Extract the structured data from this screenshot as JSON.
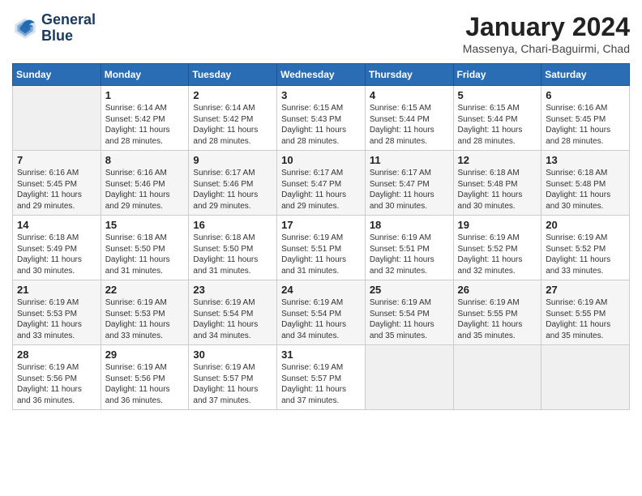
{
  "logo": {
    "line1": "General",
    "line2": "Blue"
  },
  "title": "January 2024",
  "subtitle": "Massenya, Chari-Baguirmi, Chad",
  "days_of_week": [
    "Sunday",
    "Monday",
    "Tuesday",
    "Wednesday",
    "Thursday",
    "Friday",
    "Saturday"
  ],
  "weeks": [
    [
      {
        "day": "",
        "info": ""
      },
      {
        "day": "1",
        "info": "Sunrise: 6:14 AM\nSunset: 5:42 PM\nDaylight: 11 hours\nand 28 minutes."
      },
      {
        "day": "2",
        "info": "Sunrise: 6:14 AM\nSunset: 5:42 PM\nDaylight: 11 hours\nand 28 minutes."
      },
      {
        "day": "3",
        "info": "Sunrise: 6:15 AM\nSunset: 5:43 PM\nDaylight: 11 hours\nand 28 minutes."
      },
      {
        "day": "4",
        "info": "Sunrise: 6:15 AM\nSunset: 5:44 PM\nDaylight: 11 hours\nand 28 minutes."
      },
      {
        "day": "5",
        "info": "Sunrise: 6:15 AM\nSunset: 5:44 PM\nDaylight: 11 hours\nand 28 minutes."
      },
      {
        "day": "6",
        "info": "Sunrise: 6:16 AM\nSunset: 5:45 PM\nDaylight: 11 hours\nand 28 minutes."
      }
    ],
    [
      {
        "day": "7",
        "info": "Sunrise: 6:16 AM\nSunset: 5:45 PM\nDaylight: 11 hours\nand 29 minutes."
      },
      {
        "day": "8",
        "info": "Sunrise: 6:16 AM\nSunset: 5:46 PM\nDaylight: 11 hours\nand 29 minutes."
      },
      {
        "day": "9",
        "info": "Sunrise: 6:17 AM\nSunset: 5:46 PM\nDaylight: 11 hours\nand 29 minutes."
      },
      {
        "day": "10",
        "info": "Sunrise: 6:17 AM\nSunset: 5:47 PM\nDaylight: 11 hours\nand 29 minutes."
      },
      {
        "day": "11",
        "info": "Sunrise: 6:17 AM\nSunset: 5:47 PM\nDaylight: 11 hours\nand 30 minutes."
      },
      {
        "day": "12",
        "info": "Sunrise: 6:18 AM\nSunset: 5:48 PM\nDaylight: 11 hours\nand 30 minutes."
      },
      {
        "day": "13",
        "info": "Sunrise: 6:18 AM\nSunset: 5:48 PM\nDaylight: 11 hours\nand 30 minutes."
      }
    ],
    [
      {
        "day": "14",
        "info": "Sunrise: 6:18 AM\nSunset: 5:49 PM\nDaylight: 11 hours\nand 30 minutes."
      },
      {
        "day": "15",
        "info": "Sunrise: 6:18 AM\nSunset: 5:50 PM\nDaylight: 11 hours\nand 31 minutes."
      },
      {
        "day": "16",
        "info": "Sunrise: 6:18 AM\nSunset: 5:50 PM\nDaylight: 11 hours\nand 31 minutes."
      },
      {
        "day": "17",
        "info": "Sunrise: 6:19 AM\nSunset: 5:51 PM\nDaylight: 11 hours\nand 31 minutes."
      },
      {
        "day": "18",
        "info": "Sunrise: 6:19 AM\nSunset: 5:51 PM\nDaylight: 11 hours\nand 32 minutes."
      },
      {
        "day": "19",
        "info": "Sunrise: 6:19 AM\nSunset: 5:52 PM\nDaylight: 11 hours\nand 32 minutes."
      },
      {
        "day": "20",
        "info": "Sunrise: 6:19 AM\nSunset: 5:52 PM\nDaylight: 11 hours\nand 33 minutes."
      }
    ],
    [
      {
        "day": "21",
        "info": "Sunrise: 6:19 AM\nSunset: 5:53 PM\nDaylight: 11 hours\nand 33 minutes."
      },
      {
        "day": "22",
        "info": "Sunrise: 6:19 AM\nSunset: 5:53 PM\nDaylight: 11 hours\nand 33 minutes."
      },
      {
        "day": "23",
        "info": "Sunrise: 6:19 AM\nSunset: 5:54 PM\nDaylight: 11 hours\nand 34 minutes."
      },
      {
        "day": "24",
        "info": "Sunrise: 6:19 AM\nSunset: 5:54 PM\nDaylight: 11 hours\nand 34 minutes."
      },
      {
        "day": "25",
        "info": "Sunrise: 6:19 AM\nSunset: 5:54 PM\nDaylight: 11 hours\nand 35 minutes."
      },
      {
        "day": "26",
        "info": "Sunrise: 6:19 AM\nSunset: 5:55 PM\nDaylight: 11 hours\nand 35 minutes."
      },
      {
        "day": "27",
        "info": "Sunrise: 6:19 AM\nSunset: 5:55 PM\nDaylight: 11 hours\nand 35 minutes."
      }
    ],
    [
      {
        "day": "28",
        "info": "Sunrise: 6:19 AM\nSunset: 5:56 PM\nDaylight: 11 hours\nand 36 minutes."
      },
      {
        "day": "29",
        "info": "Sunrise: 6:19 AM\nSunset: 5:56 PM\nDaylight: 11 hours\nand 36 minutes."
      },
      {
        "day": "30",
        "info": "Sunrise: 6:19 AM\nSunset: 5:57 PM\nDaylight: 11 hours\nand 37 minutes."
      },
      {
        "day": "31",
        "info": "Sunrise: 6:19 AM\nSunset: 5:57 PM\nDaylight: 11 hours\nand 37 minutes."
      },
      {
        "day": "",
        "info": ""
      },
      {
        "day": "",
        "info": ""
      },
      {
        "day": "",
        "info": ""
      }
    ]
  ]
}
